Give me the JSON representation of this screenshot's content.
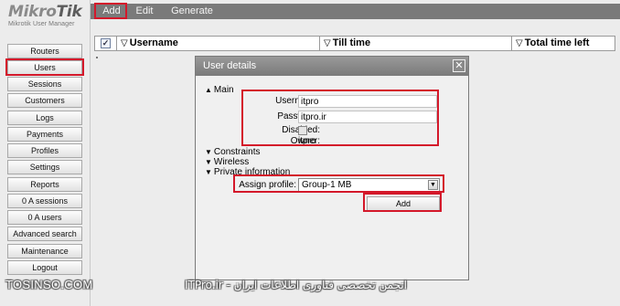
{
  "logo": {
    "brand_prefix": "Mikro",
    "brand_suffix": "Tik",
    "subtitle": "Mikrotik User Manager"
  },
  "toolbar": {
    "add_label": "Add",
    "edit_label": "Edit",
    "generate_label": "Generate",
    "background": "#7a7a7a"
  },
  "sidebar": {
    "items": [
      {
        "label": "Routers"
      },
      {
        "label": "Users"
      },
      {
        "label": "Sessions"
      },
      {
        "label": "Customers"
      },
      {
        "label": "Logs"
      },
      {
        "label": "Payments"
      },
      {
        "label": "Profiles"
      },
      {
        "label": "Settings"
      },
      {
        "label": "Reports"
      },
      {
        "label": "0 A sessions"
      },
      {
        "label": "0 A users"
      },
      {
        "label": "Advanced search"
      },
      {
        "label": "Maintenance"
      },
      {
        "label": "Logout"
      }
    ]
  },
  "table": {
    "select_all_checked": true,
    "columns": [
      {
        "label": "Username"
      },
      {
        "label": "Till time"
      },
      {
        "label": "Total time left"
      }
    ]
  },
  "dialog": {
    "title": "User details",
    "close_icon": "close-icon",
    "sections": {
      "main": "Main",
      "constraints": "Constraints",
      "wireless": "Wireless",
      "private_information": "Private information"
    },
    "fields": {
      "username_label": "Username:",
      "username_value": "itpro",
      "password_label": "Password:",
      "password_value": "itpro.ir",
      "disabled_label": "Disabled:",
      "disabled_checked": false,
      "owner_label": "Owner:",
      "owner_value": "itpro"
    },
    "assign_profile_label": "Assign profile:",
    "assign_profile_value": "Group-1 MB",
    "add_button_label": "Add"
  },
  "highlight_color": "#d4182a",
  "watermark": {
    "left_text": "TOSINSO.COM",
    "right_text": "ITPro.ir - انجمن تخصصی فناوری اطلاعات ایران"
  }
}
